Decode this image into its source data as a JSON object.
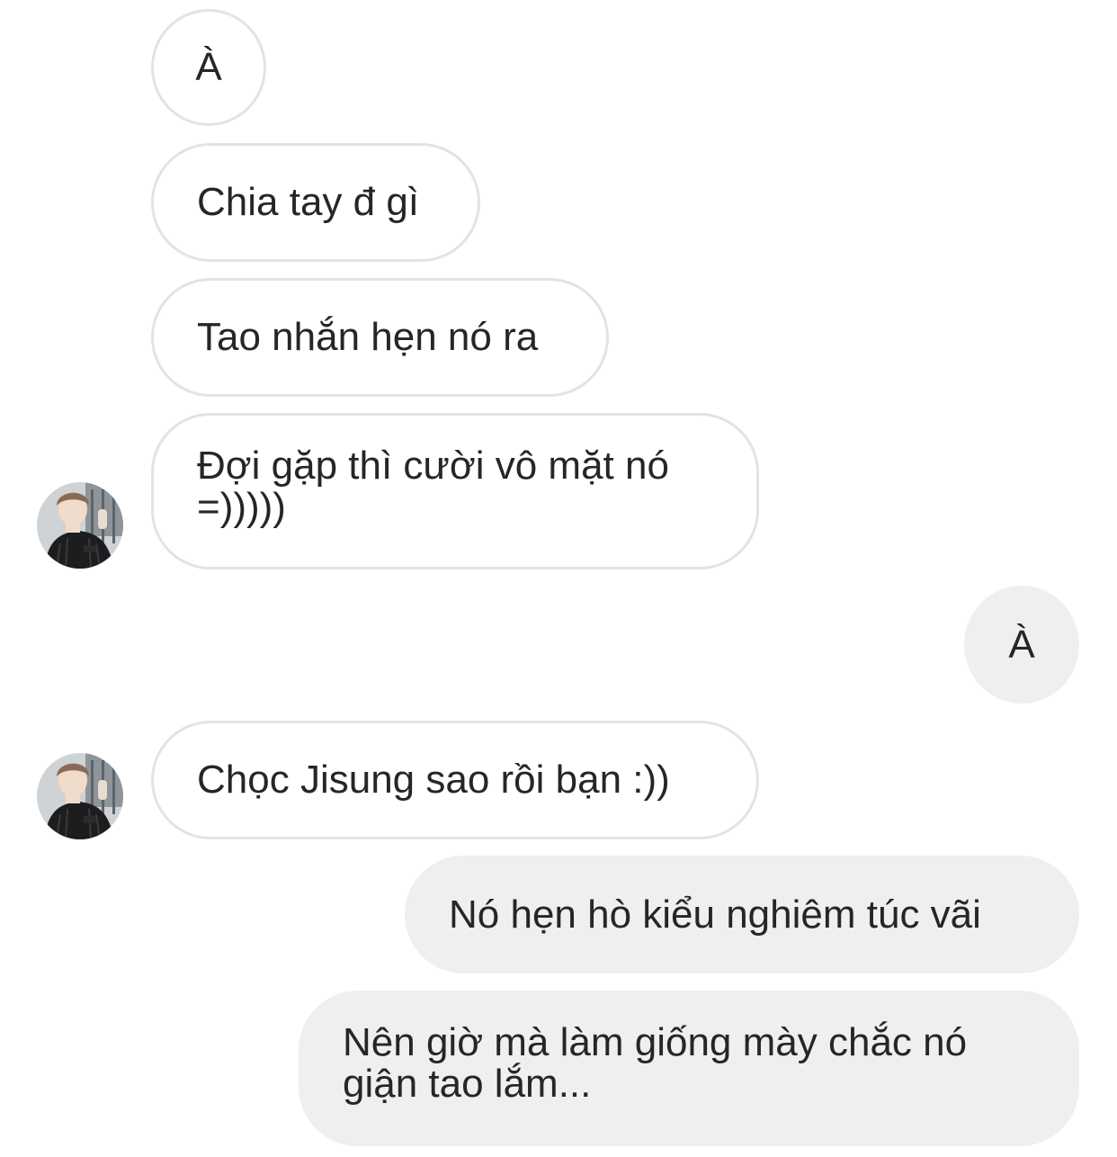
{
  "messages": [
    {
      "id": "m1",
      "side": "incoming",
      "text": "À"
    },
    {
      "id": "m2",
      "side": "incoming",
      "text": "Chia tay đ gì"
    },
    {
      "id": "m3",
      "side": "incoming",
      "text": "Tao nhắn hẹn nó ra"
    },
    {
      "id": "m4",
      "side": "incoming",
      "lines": [
        "Đợi gặp thì cười vô mặt nó",
        "=)))))"
      ]
    },
    {
      "id": "m5",
      "side": "outgoing",
      "text": "À"
    },
    {
      "id": "m6",
      "side": "incoming",
      "text": "Chọc Jisung sao rồi bạn :))"
    },
    {
      "id": "m7",
      "side": "outgoing",
      "text": "Nó hẹn hò kiểu nghiêm túc vãi"
    },
    {
      "id": "m8",
      "side": "outgoing",
      "lines": [
        "Nên giờ mà làm giống mày chắc nó",
        "giận tao lắm..."
      ]
    }
  ],
  "avatar": {
    "icon": "user-avatar-photo",
    "shirt_number": "77"
  },
  "colors": {
    "incoming_bg": "#ffffff",
    "incoming_border": "#e3e3e3",
    "outgoing_bg": "#efefef",
    "text": "#262626"
  }
}
